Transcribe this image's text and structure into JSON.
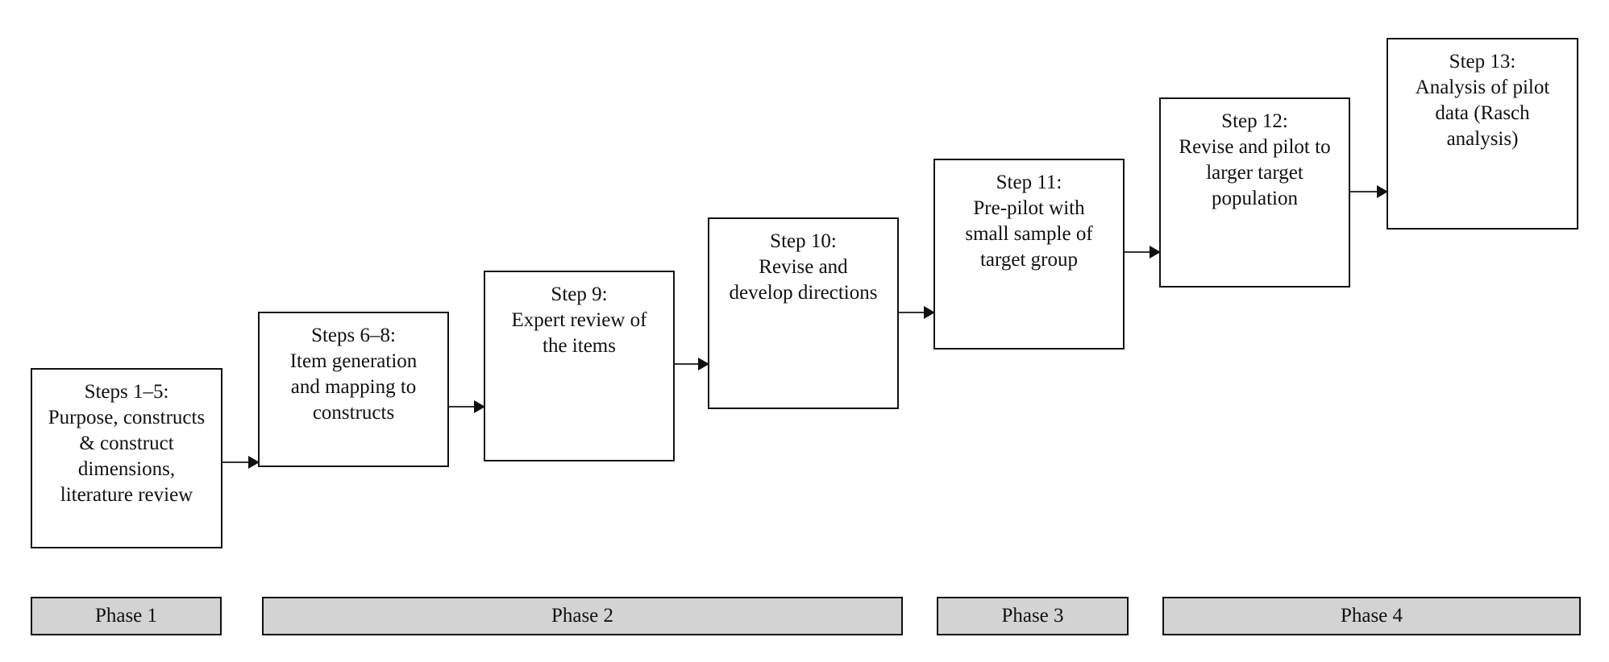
{
  "steps": [
    {
      "lines": [
        "Steps 1–5:",
        "Purpose, constructs",
        "& construct",
        "dimensions,",
        "literature review"
      ]
    },
    {
      "lines": [
        "Steps 6–8:",
        "Item generation",
        "and mapping to",
        "constructs"
      ]
    },
    {
      "lines": [
        "Step 9:",
        "Expert review of",
        "the items"
      ]
    },
    {
      "lines": [
        "Step 10:",
        "Revise and",
        "develop directions"
      ]
    },
    {
      "lines": [
        "Step 11:",
        "Pre-pilot with",
        "small sample of",
        "target group"
      ]
    },
    {
      "lines": [
        "Step 12:",
        "Revise and pilot to",
        "larger target",
        "population"
      ]
    },
    {
      "lines": [
        "Step 13:",
        "Analysis of pilot",
        "data (Rasch",
        "analysis)"
      ]
    }
  ],
  "phases": [
    {
      "label": "Phase 1"
    },
    {
      "label": "Phase 2"
    },
    {
      "label": "Phase 3"
    },
    {
      "label": "Phase 4"
    }
  ],
  "colors": {
    "phase_fill": "#d3d3d3",
    "border": "#111111"
  }
}
